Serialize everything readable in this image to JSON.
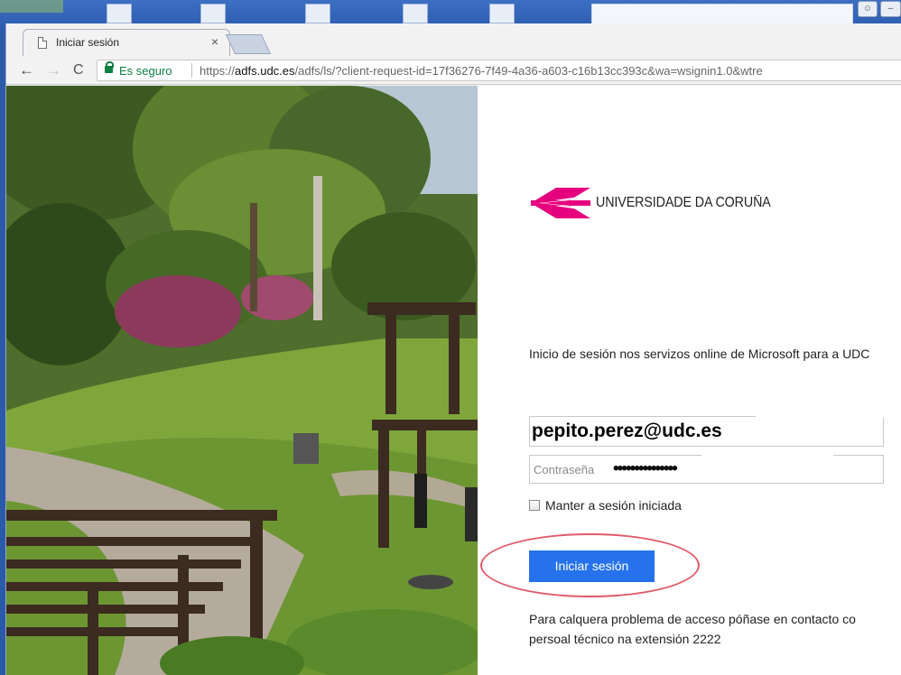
{
  "browser": {
    "tab_title": "Iniciar sesión",
    "tab_close": "×",
    "security_label": "Es seguro",
    "url_prefix": "https://",
    "url_host": "adfs.udc.es",
    "url_rest": "/adfs/ls/?client-request-id=17f36276-7f49-4a36-a603-c16b13cc393c&wa=wsignin1.0&wtre",
    "back_glyph": "←",
    "forward_glyph": "→",
    "reload_glyph": "C"
  },
  "login": {
    "logo_text": "UNIVERSIDADE DA CORUÑA",
    "intro_text": "Inicio de sesión nos servizos online de Microsoft para a UDC",
    "username_value": "pepito.perez@udc.es",
    "password_placeholder": "Contraseña",
    "password_mask": "•••••••••••••••",
    "keep_signed_in_label": "Manter a sesión iniciada",
    "submit_label": "Iniciar sesión",
    "help_text": "Para calquera problema de acceso póñase en contacto co persoal técnico na extensión 2222"
  },
  "colors": {
    "accent_button": "#2672ec",
    "logo_magenta": "#e5007e",
    "highlight_ring": "#e05a6a",
    "secure_green": "#0b8043"
  },
  "icons": {
    "tab": "document-icon",
    "secure": "lock-icon"
  }
}
